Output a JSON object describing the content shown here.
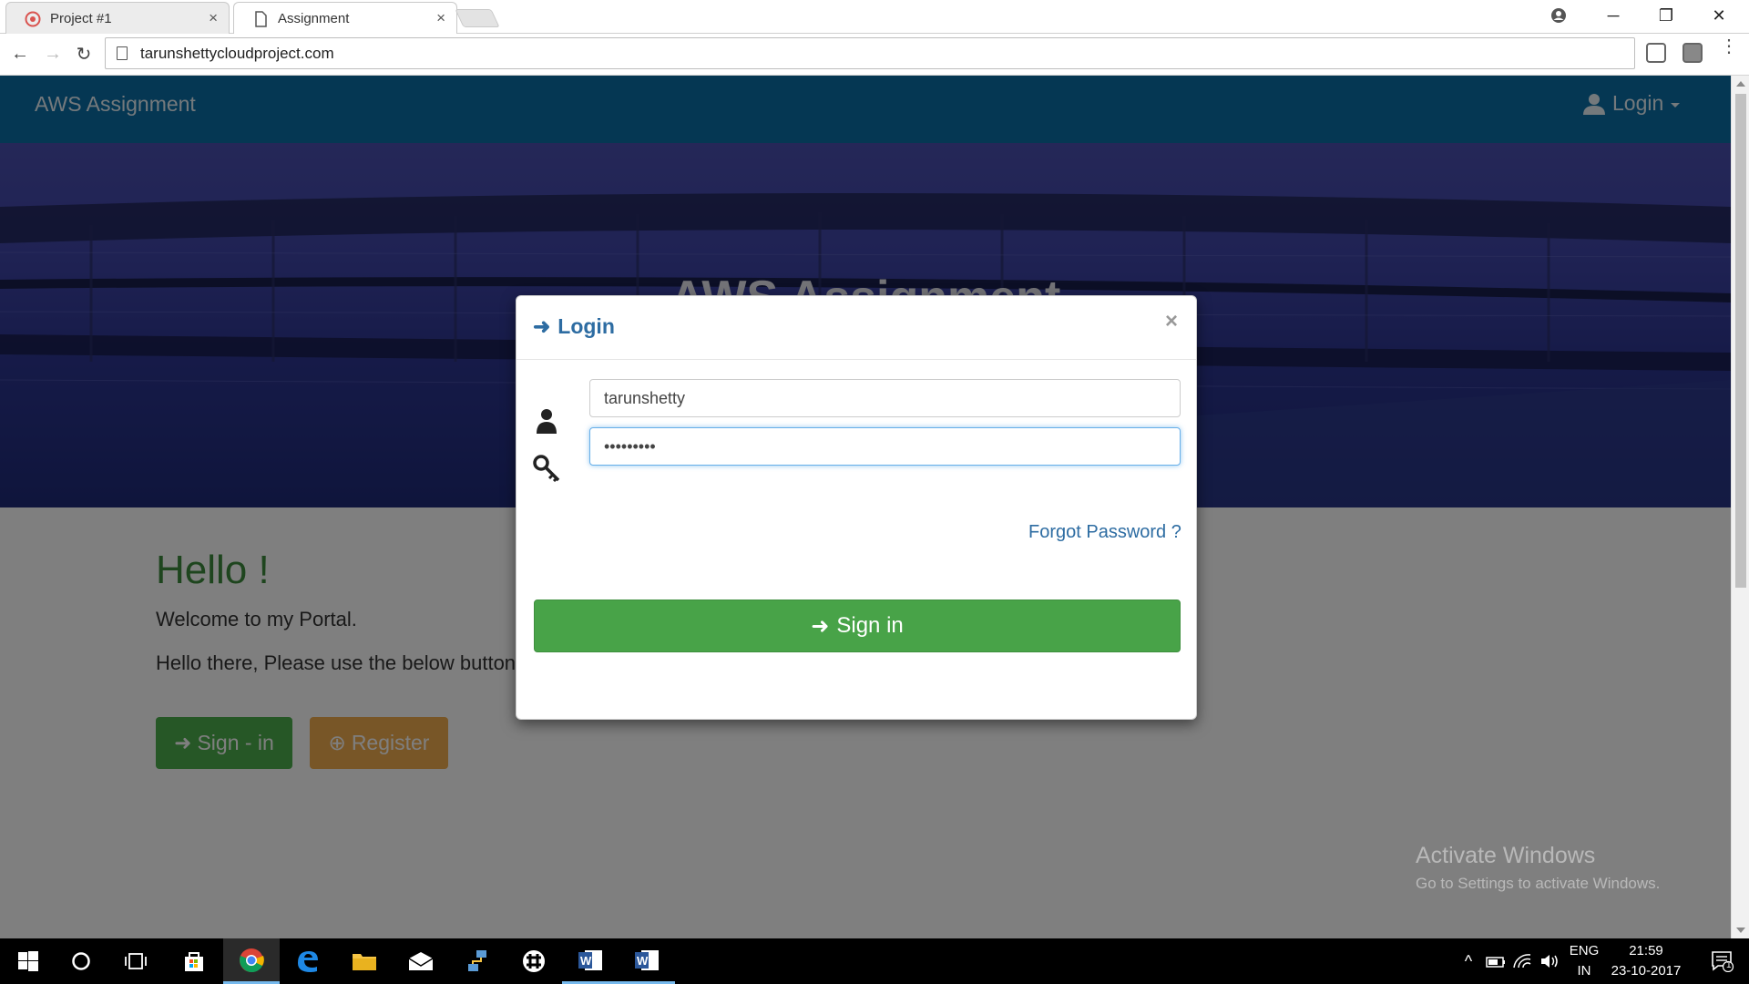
{
  "browser": {
    "tabs": [
      {
        "label": "Project #1",
        "close": "×"
      },
      {
        "label": "Assignment",
        "close": "×"
      }
    ],
    "url": "tarunshettycloudproject.com",
    "window_controls": {
      "minimize": "─",
      "restore": "❐",
      "close": "✕"
    }
  },
  "page": {
    "navbar": {
      "brand": "AWS Assignment",
      "login_label": "Login"
    },
    "hero_title": "AWS Assignment",
    "hello": "Hello !",
    "welcome": "Welcome to my Portal.",
    "hello_there": "Hello there, Please use the below button",
    "signin_button": "Sign - in",
    "register_button": "Register"
  },
  "modal": {
    "title": "Login",
    "close": "×",
    "username_value": "tarunshetty",
    "password_value": "•••••••••",
    "forgot_password": "Forgot Password ?",
    "signin_button": "Sign in"
  },
  "watermark": {
    "line1": "Activate Windows",
    "line2": "Go to Settings to activate Windows."
  },
  "taskbar": {
    "lang_line1": "ENG",
    "lang_line2": "IN",
    "time": "21:59",
    "date": "23-10-2017",
    "notification_count": "1"
  },
  "colors": {
    "navbar": "#0b6fa7",
    "success": "#48a348",
    "warning": "#f0ad4e",
    "link": "#2d6ca2"
  }
}
